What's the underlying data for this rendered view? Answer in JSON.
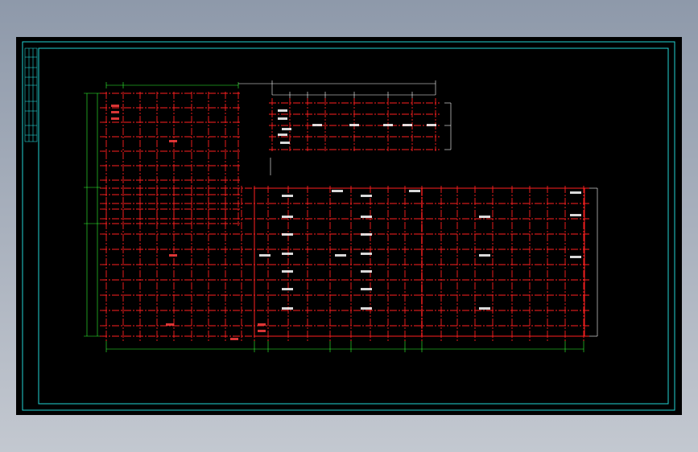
{
  "drawing": {
    "colors": {
      "background": "#000000",
      "frame": "#22d3d3",
      "grid": "#ff2020",
      "dimension_line": "#33ff33",
      "text": "#ffffff"
    }
  }
}
